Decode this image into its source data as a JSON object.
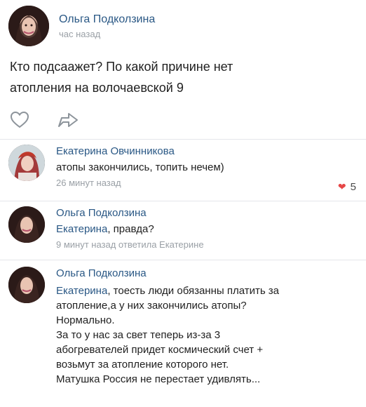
{
  "post": {
    "author": "Ольга Подколзина",
    "time": "час назад",
    "text_line1": "Кто подсаажет? По какой причине нет",
    "text_line2": "атопления на волочаевской 9"
  },
  "actions": {
    "like_icon": "heart-outline-icon",
    "share_icon": "share-arrow-icon"
  },
  "comments": [
    {
      "author": "Екатерина Овчинникова",
      "text": "атопы закончились, топить нечем)",
      "meta": "26 минут назад",
      "likes": "5"
    },
    {
      "author": "Ольга Подколзина",
      "mention": "Екатерина",
      "text": ", правда?",
      "meta": "9 минут назад ответила Екатерине"
    },
    {
      "author": "Ольга Подколзина",
      "mention": "Екатерина",
      "lines": [
        ", тоесть люди обязанны платить за",
        "атопление,а у них закончились атопы?",
        "Нормально.",
        "За то у нас за свет теперь из-за 3",
        "абогревателей придет космический счет +",
        "возьмут за атопление которого нет.",
        "Матушка Россия не перестает удивлять..."
      ]
    }
  ],
  "colors": {
    "link": "#2a5885",
    "meta": "#9aa0a6",
    "heart": "#e64646"
  }
}
